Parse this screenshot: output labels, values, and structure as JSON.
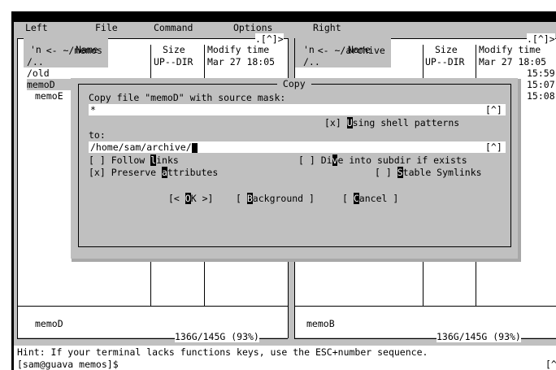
{
  "menu": {
    "left": "Left",
    "file": "File",
    "command": "Command",
    "options": "Options",
    "right": "Right"
  },
  "left_panel": {
    "path_prefix": "<-",
    "path": " ~/memos ",
    "path_suffix": ".[^]>",
    "col_sort": "'n",
    "col_name": "Name",
    "col_size": "Size",
    "col_mtime": "Modify time",
    "files": [
      {
        "name": "/..",
        "size": "UP--DIR",
        "mtime": "Mar 27 18:05"
      },
      {
        "name": "/old",
        "size": "",
        "mtime": ""
      },
      {
        "name": "memoD",
        "size": "",
        "mtime": ""
      },
      {
        "name": "memoE",
        "size": "",
        "mtime": ""
      }
    ],
    "mini_status": "memoD",
    "disk_usage": "136G/145G (93%)"
  },
  "right_panel": {
    "path_prefix": "<-",
    "path": " ~/archive ",
    "path_suffix": ".[^]>",
    "col_sort": "'n",
    "col_name": "Name",
    "col_size": "Size",
    "col_mtime": "Modify time",
    "files": [
      {
        "name": "/..",
        "size": "UP--DIR",
        "mtime": "Mar 27 18:05"
      },
      {
        "name": "",
        "size": "",
        "mtime": "15:59"
      },
      {
        "name": "",
        "size": "",
        "mtime": "15:07"
      },
      {
        "name": "",
        "size": "",
        "mtime": "15:08"
      }
    ],
    "mini_status": "memoB",
    "disk_usage": "136G/145G (93%)"
  },
  "dialog": {
    "title": " Copy ",
    "source_label": "Copy file \"memoD\" with source mask:",
    "source_value": "*",
    "history_btn": "[^]",
    "shell_patterns": {
      "check": "[x] ",
      "hotkey": "U",
      "rest": "sing shell patterns"
    },
    "to_label": "to:",
    "to_value": "/home/sam/archive/",
    "follow_links": {
      "check": "[ ] Follow ",
      "hotkey": "l",
      "rest": "inks"
    },
    "dive_subdir": {
      "check": "[ ] Di",
      "hotkey": "v",
      "rest": "e into subdir if exists"
    },
    "preserve_attrs": {
      "check": "[x] Preserve ",
      "hotkey": "a",
      "rest": "ttributes"
    },
    "stable_symlinks": {
      "check": "[ ] ",
      "hotkey": "S",
      "rest": "table Symlinks"
    },
    "ok_btn": {
      "pre": "[< ",
      "hotkey": "O",
      "rest": "K >]"
    },
    "background_btn": {
      "pre": "[ ",
      "hotkey": "B",
      "rest": "ackground ]"
    },
    "cancel_btn": {
      "pre": "[ ",
      "hotkey": "C",
      "rest": "ancel ]"
    }
  },
  "hint": "Hint: If your terminal lacks functions keys, use the ESC+number sequence.",
  "prompt": "[sam@guava memos]$",
  "prompt_history": "[^"
}
